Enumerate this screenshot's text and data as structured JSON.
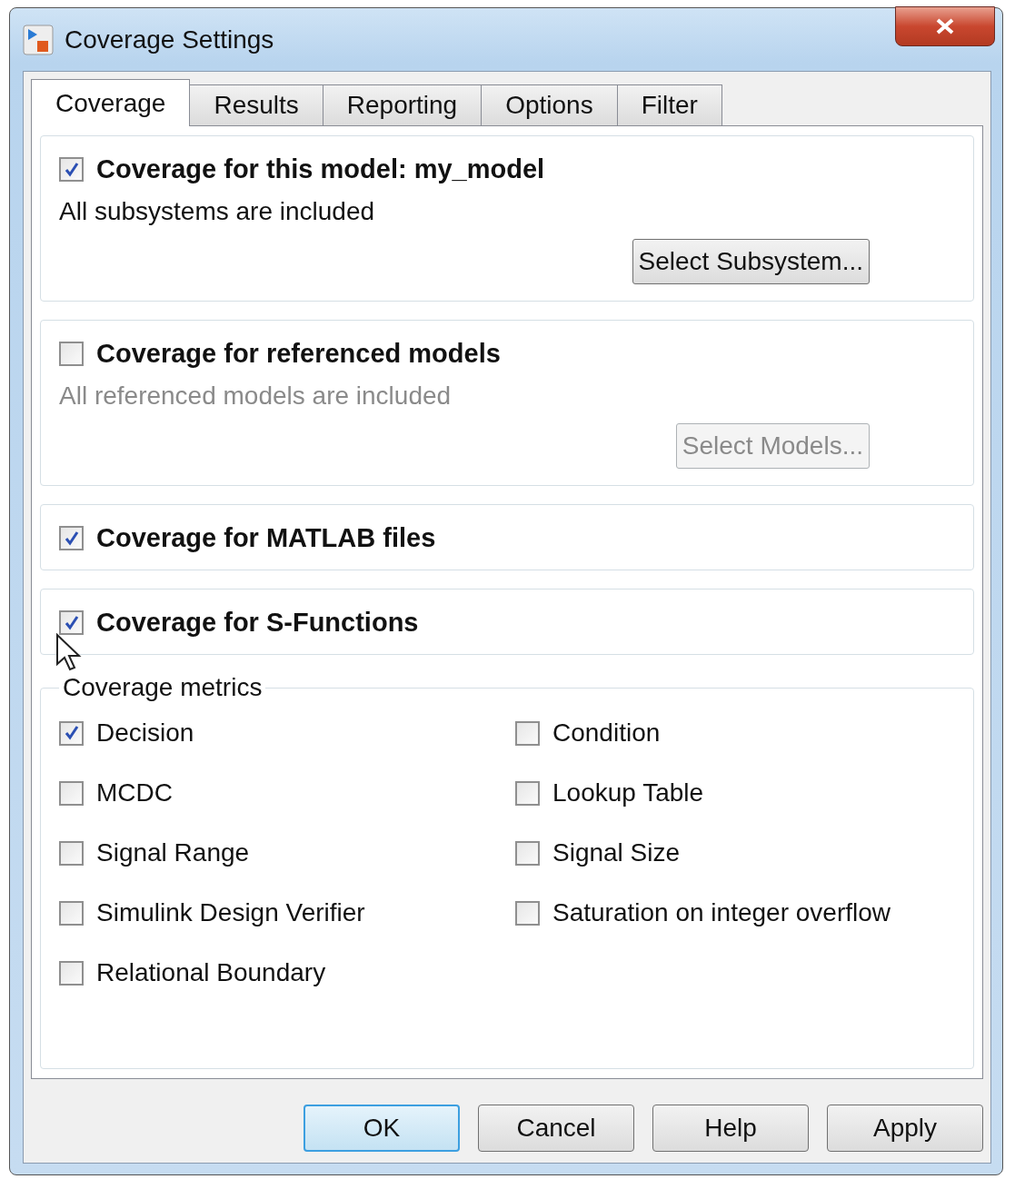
{
  "window": {
    "title": "Coverage Settings"
  },
  "tabs": [
    {
      "label": "Coverage",
      "selected": true
    },
    {
      "label": "Results",
      "selected": false
    },
    {
      "label": "Reporting",
      "selected": false
    },
    {
      "label": "Options",
      "selected": false
    },
    {
      "label": "Filter",
      "selected": false
    }
  ],
  "sections": [
    {
      "title": "Coverage for this model: my_model",
      "checked": true,
      "description": "All subsystems are included",
      "button": "Select Subsystem..."
    },
    {
      "title": "Coverage for referenced models",
      "checked": false,
      "description": "All referenced models are included",
      "button": "Select Models..."
    },
    {
      "title": "Coverage for MATLAB files",
      "checked": true
    },
    {
      "title": "Coverage for S-Functions",
      "checked": true,
      "cursor": true
    }
  ],
  "metrics": {
    "legend": "Coverage metrics",
    "items": [
      {
        "label": "Decision",
        "checked": true
      },
      {
        "label": "Condition",
        "checked": false
      },
      {
        "label": "MCDC",
        "checked": false
      },
      {
        "label": "Lookup Table",
        "checked": false
      },
      {
        "label": "Signal Range",
        "checked": false
      },
      {
        "label": "Signal Size",
        "checked": false
      },
      {
        "label": "Simulink Design Verifier",
        "checked": false
      },
      {
        "label": "Saturation on integer overflow",
        "checked": false
      },
      {
        "label": "Relational Boundary",
        "checked": false
      }
    ]
  },
  "buttons": [
    {
      "label": "OK",
      "default": true
    },
    {
      "label": "Cancel",
      "default": false
    },
    {
      "label": "Help",
      "default": false
    },
    {
      "label": "Apply",
      "default": false
    }
  ]
}
